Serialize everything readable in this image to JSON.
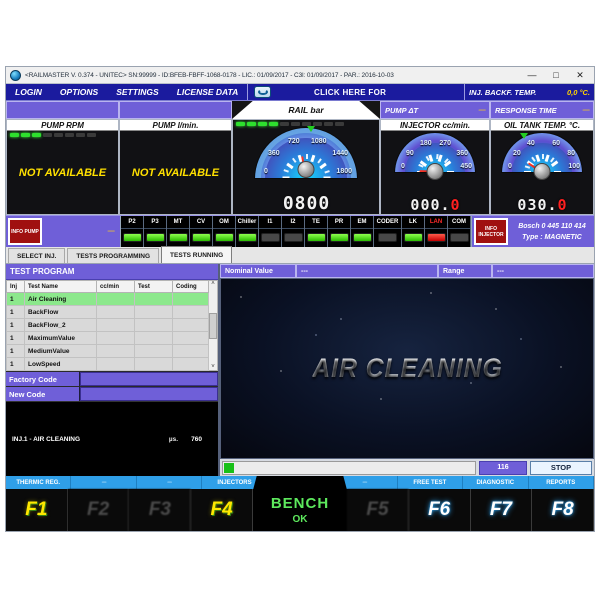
{
  "window": {
    "title": "<RAILMASTER V. 0.374 - UNITEC>   SN:99999 - ID:BFEB-FBFF-1068-0178 -  LIC.: 01/09/2017 - C3l: 01/09/2017 - PAR.: 2016-10-03",
    "minimize": "—",
    "maximize": "□",
    "close": "✕"
  },
  "menubar": {
    "items": [
      "LOGIN",
      "OPTIONS",
      "SETTINGS",
      "LICENSE DATA"
    ],
    "click_here": "CLICK HERE FOR",
    "backf_label": "INJ. BACKF. TEMP.",
    "backf_value": "0,0 °C."
  },
  "subbar": {
    "rail_tab": "RAIL bar",
    "pump_dt_label": "PUMP ΔT",
    "pump_dt_value": "-----",
    "response_label": "RESPONSE TIME",
    "response_value": "-----"
  },
  "gauges": {
    "pump_rpm": {
      "title": "PUMP RPM",
      "status": "NOT AVAILABLE"
    },
    "pump_lmin": {
      "title": "PUMP  l/min.",
      "status": "NOT AVAILABLE"
    },
    "rail": {
      "title": "RAIL bar",
      "labels": [
        "0",
        "360",
        "720",
        "1080",
        "1440",
        "1800"
      ],
      "min": 0,
      "max": 1800,
      "value": 800,
      "digits": [
        "0",
        "8",
        "0",
        "0"
      ]
    },
    "injector": {
      "title": "INJECTOR cc/min.",
      "labels": [
        "0",
        "90",
        "180",
        "270",
        "360",
        "450"
      ],
      "min": 0,
      "max": 450,
      "value": 0,
      "digits": [
        "0",
        "0",
        "0",
        ".",
        "0"
      ]
    },
    "oiltank": {
      "title": "OIL TANK TEMP. °C.",
      "labels": [
        "0",
        "20",
        "40",
        "60",
        "80",
        "100"
      ],
      "min": 0,
      "max": 100,
      "value": 30,
      "digits": [
        "0",
        "3",
        "0",
        ".",
        "0"
      ]
    }
  },
  "status": {
    "info_pump": "INFO PUMP",
    "info_injector": "INFO INJECTOR",
    "gap_dash": "-----",
    "leds": [
      {
        "name": "P2",
        "state": "green"
      },
      {
        "name": "P3",
        "state": "green"
      },
      {
        "name": "MT",
        "state": "green"
      },
      {
        "name": "CV",
        "state": "green"
      },
      {
        "name": "OM",
        "state": "green"
      },
      {
        "name": "Chiller",
        "state": "green"
      },
      {
        "name": "I1",
        "state": "off"
      },
      {
        "name": "I2",
        "state": "off"
      },
      {
        "name": "TE",
        "state": "green"
      },
      {
        "name": "PR",
        "state": "green"
      },
      {
        "name": "EM",
        "state": "green"
      },
      {
        "name": "CODER",
        "state": "off"
      },
      {
        "name": "LK",
        "state": "green"
      },
      {
        "name": "LAN",
        "state": "red"
      },
      {
        "name": "COM",
        "state": "off"
      }
    ],
    "bosch_code": "Bosch 0 445 110 414",
    "bosch_type": "Type : MAGNETIC"
  },
  "tabs": [
    {
      "label": "SELECT INJ.",
      "active": false
    },
    {
      "label": "TESTS PROGRAMMING",
      "active": false
    },
    {
      "label": "TESTS RUNNING",
      "active": true
    }
  ],
  "test_program": {
    "title": "TEST PROGRAM",
    "columns": [
      "Inj",
      "Test Name",
      "cc/min",
      "Test",
      "Coding"
    ],
    "rows": [
      {
        "inj": "1",
        "name": "Air Cleaning",
        "ccmin": "",
        "test": "",
        "coding": "",
        "selected": true
      },
      {
        "inj": "1",
        "name": "BackFlow",
        "ccmin": "",
        "test": "",
        "coding": "",
        "selected": false
      },
      {
        "inj": "1",
        "name": "BackFlow_2",
        "ccmin": "",
        "test": "",
        "coding": "",
        "selected": false
      },
      {
        "inj": "1",
        "name": "MaximumValue",
        "ccmin": "",
        "test": "",
        "coding": "",
        "selected": false
      },
      {
        "inj": "1",
        "name": "MediumValue",
        "ccmin": "",
        "test": "",
        "coding": "",
        "selected": false
      },
      {
        "inj": "1",
        "name": "LowSpeed",
        "ccmin": "",
        "test": "",
        "coding": "",
        "selected": false
      }
    ],
    "factory_code_label": "Factory Code",
    "factory_code_value": "",
    "new_code_label": "New Code",
    "new_code_value": "",
    "scroll_up": "˄",
    "scroll_down": "˅"
  },
  "running": {
    "inj_status": "INJ.1 - AIR CLEANING",
    "unit": "µs.",
    "unit_value": "760",
    "nominal_label": "Nominal Value",
    "nominal_value": "---",
    "range_label": "Range",
    "range_value": "---",
    "stage_text": "AIR CLEANING",
    "progress_percent": 2,
    "counter": "116",
    "stop_label": "STOP"
  },
  "function_bar": {
    "labels": [
      "THERMIC REG.",
      "----",
      "----",
      "INJECTORS",
      "----",
      "FREE TEST",
      "DIAGNOSTIC",
      "REPORTS"
    ],
    "keys": [
      {
        "key": "F1",
        "style": "yellow"
      },
      {
        "key": "F2",
        "style": "dim"
      },
      {
        "key": "F3",
        "style": "dim"
      },
      {
        "key": "F4",
        "style": "yellow"
      },
      {
        "key": "F5",
        "style": "dim"
      },
      {
        "key": "F6",
        "style": "blue"
      },
      {
        "key": "F7",
        "style": "blue"
      },
      {
        "key": "F8",
        "style": "blue"
      }
    ],
    "bench_title": "BENCH",
    "bench_status": "OK"
  },
  "colors": {
    "accent_blue": "#1b1b9e",
    "panel_purple": "#6f5fd8",
    "led_green": "#2ee02e",
    "led_red": "#c40000",
    "fn_blue": "#2f9fe8"
  }
}
